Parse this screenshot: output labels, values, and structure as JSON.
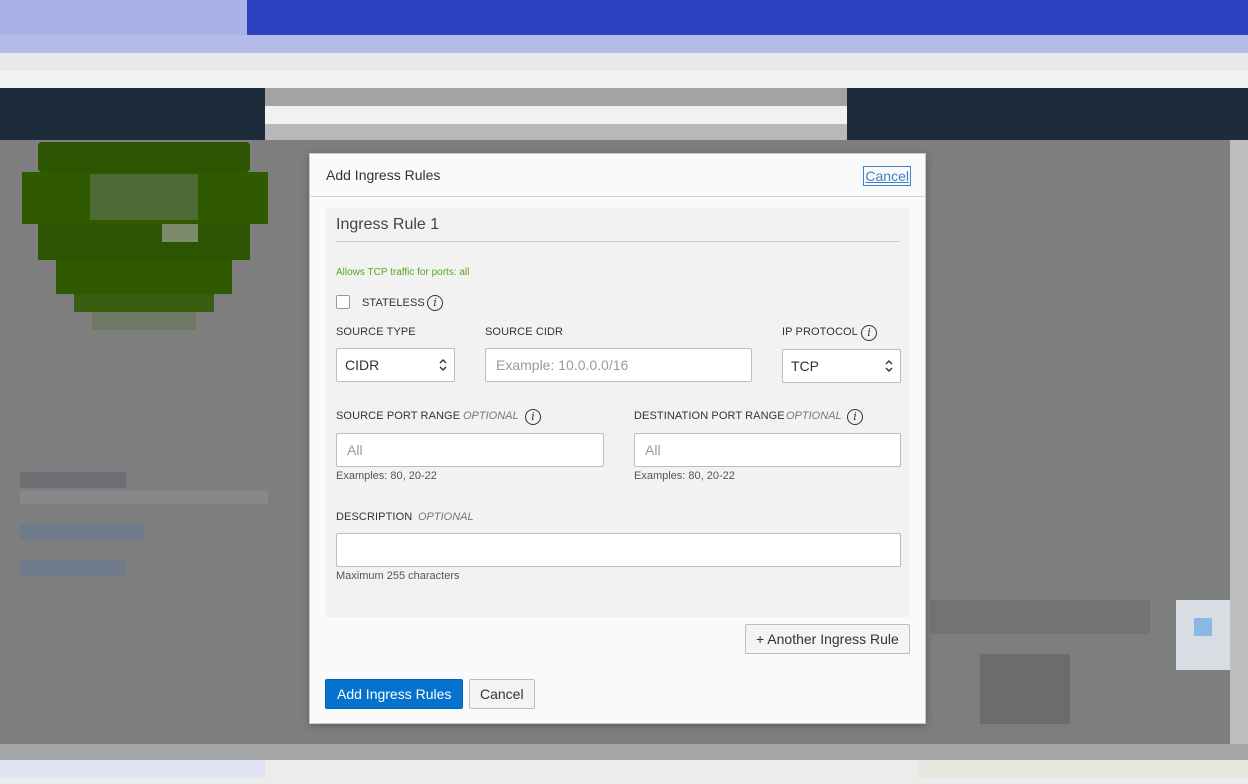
{
  "modal": {
    "title": "Add Ingress Rules",
    "header_cancel": "Cancel",
    "rule": {
      "title": "Ingress Rule 1",
      "summary": "Allows TCP traffic for ports: all",
      "stateless_label": "STATELESS",
      "stateless_checked": false,
      "source_type": {
        "label": "SOURCE TYPE",
        "value": "CIDR"
      },
      "source_cidr": {
        "label": "SOURCE CIDR",
        "placeholder": "Example: 10.0.0.0/16"
      },
      "ip_protocol": {
        "label": "IP PROTOCOL",
        "value": "TCP"
      },
      "source_port_range": {
        "label": "SOURCE PORT RANGE",
        "optional": "OPTIONAL",
        "placeholder": "All",
        "hint": "Examples: 80, 20-22"
      },
      "destination_port_range": {
        "label": "DESTINATION PORT RANGE",
        "optional": "OPTIONAL",
        "placeholder": "All",
        "hint": "Examples: 80, 20-22"
      },
      "description": {
        "label": "DESCRIPTION",
        "optional": "OPTIONAL",
        "hint": "Maximum 255 characters"
      }
    },
    "another_rule_button": "+ Another Ingress Rule",
    "submit_button": "Add Ingress Rules",
    "cancel_button": "Cancel"
  },
  "colors": {
    "primary": "#0572ce",
    "summary_green": "#5aa61e",
    "link": "#3a83c9"
  },
  "icons": {
    "info": "info-icon",
    "select_chevron": "chevron-up-down-icon"
  }
}
